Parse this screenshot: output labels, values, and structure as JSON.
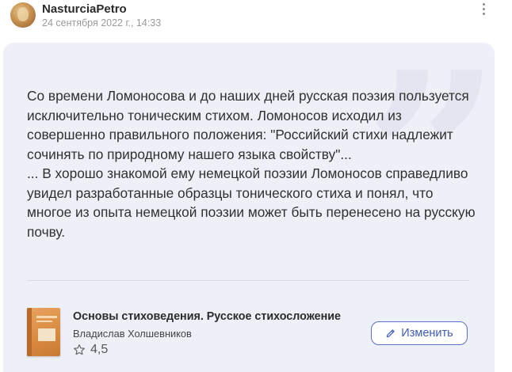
{
  "post": {
    "username": "NasturciaPetro",
    "datetime": "24 сентября 2022 г., 14:33",
    "menu_icon": "more-vertical-icon"
  },
  "quote": {
    "text": "Со времени Ломоносова и до наших дней русская поэзия пользуется исключительно тоническим стихом. Ломоносов исходил из совершенно правильного положения: \"Российский стихи надлежит сочинять по природному нашего языка свойству\"...\n... В хорошо знакомой ему немецкой поэзии Ломоносов справедливо увидел разработанные образцы тонического стиха и понял, что многое из опыта немецкой поэзии может быть перенесено на русскую почву.",
    "background_color": "#eef0f7"
  },
  "book": {
    "title": "Основы стиховедения. Русское стихосложение",
    "author": "Владислав Холшевников",
    "rating": "4,5",
    "rating_icon": "star-icon"
  },
  "actions": {
    "edit_label": "Изменить",
    "edit_icon": "pencil-icon",
    "accent_color": "#3f5bb7"
  }
}
